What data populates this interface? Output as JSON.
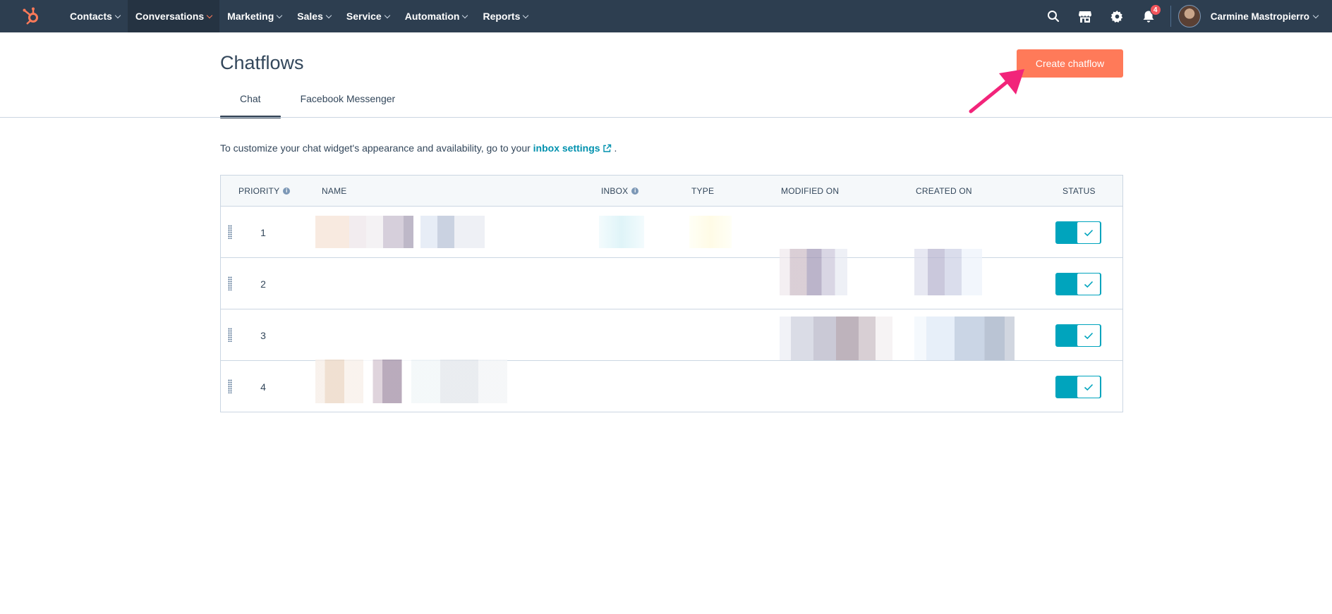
{
  "nav": {
    "items": [
      {
        "label": "Contacts"
      },
      {
        "label": "Conversations"
      },
      {
        "label": "Marketing"
      },
      {
        "label": "Sales"
      },
      {
        "label": "Service"
      },
      {
        "label": "Automation"
      },
      {
        "label": "Reports"
      }
    ],
    "active_item": "Conversations",
    "notification_count": "4",
    "user_name": "Carmine Mastropierro"
  },
  "header": {
    "title": "Chatflows",
    "create_button": "Create chatflow"
  },
  "tabs": [
    {
      "label": "Chat",
      "active": true
    },
    {
      "label": "Facebook Messenger",
      "active": false
    }
  ],
  "info": {
    "prefix": "To customize your chat widget's appearance and availability, go to your",
    "link": "inbox settings",
    "suffix": "."
  },
  "table": {
    "columns": {
      "priority": "PRIORITY",
      "name": "NAME",
      "inbox": "INBOX",
      "type": "TYPE",
      "modified_on": "MODIFIED ON",
      "created_on": "CREATED ON",
      "status": "STATUS"
    },
    "rows": [
      {
        "priority": "1",
        "status": true
      },
      {
        "priority": "2",
        "status": true
      },
      {
        "priority": "3",
        "status": true
      },
      {
        "priority": "4",
        "status": true
      }
    ]
  },
  "colors": {
    "nav_bg": "#2d3e50",
    "accent": "#ff7a59",
    "toggle_on": "#00a4bd",
    "link": "#0091ae",
    "annotation_arrow": "#f2247a"
  },
  "icons": {
    "logo": "hubspot-sprocket-icon",
    "search": "search-icon",
    "marketplace": "marketplace-icon",
    "settings": "gear-icon",
    "notifications": "bell-icon"
  }
}
